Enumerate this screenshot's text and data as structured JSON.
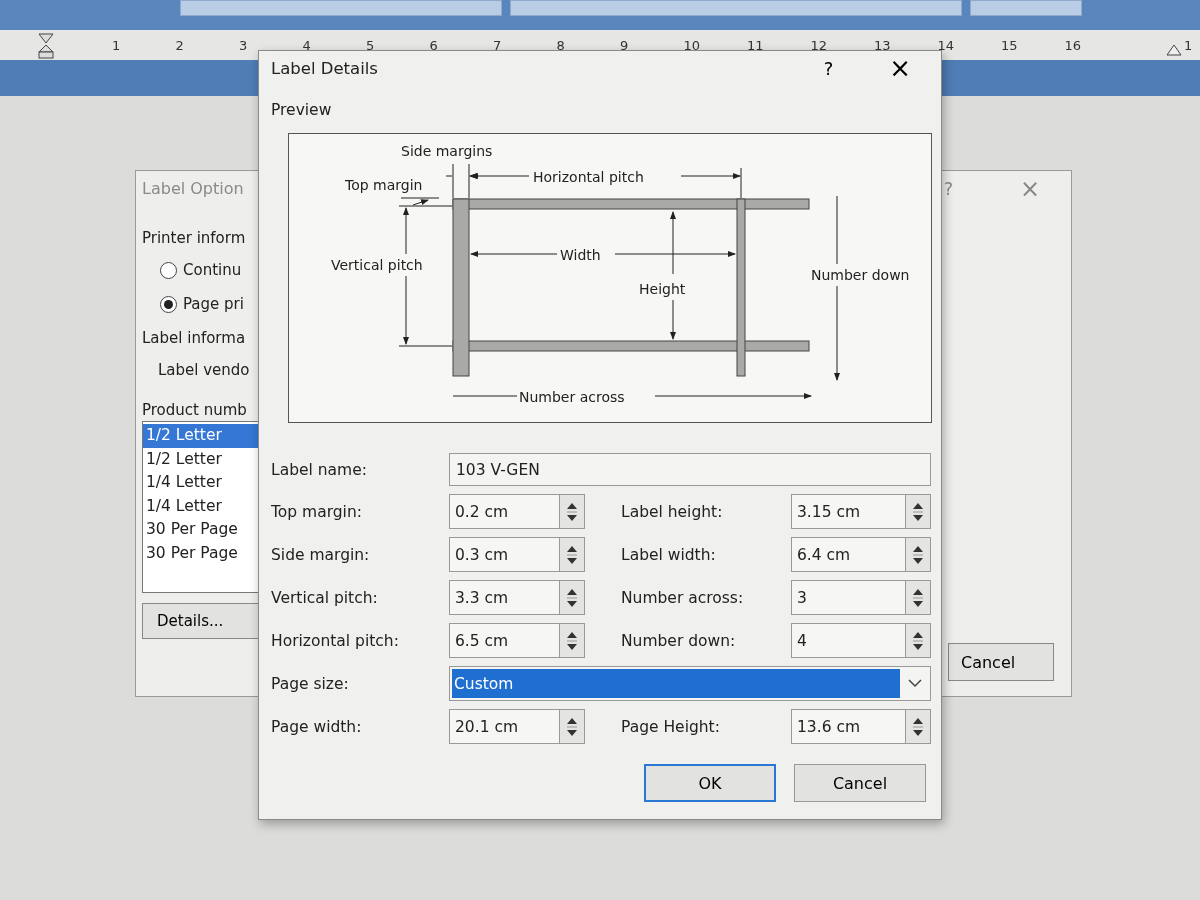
{
  "ruler": {
    "numbers": [
      "1",
      "2",
      "3",
      "4",
      "5",
      "6",
      "7",
      "8",
      "9",
      "10",
      "11",
      "12",
      "13",
      "14",
      "15",
      "16",
      "1"
    ]
  },
  "label_options_dialog": {
    "title": "Label Option",
    "help_button": "?",
    "close_button": "×",
    "printer_info_label": "Printer inform",
    "printer_types": [
      {
        "label": "Continu",
        "selected": false
      },
      {
        "label": "Page pri",
        "selected": true
      }
    ],
    "label_info_label": "Label informa",
    "vendor_label": "Label vendo",
    "product_label": "Product numb",
    "products": [
      {
        "label": "1/2 Letter",
        "selected": true
      },
      {
        "label": "1/2 Letter",
        "selected": false
      },
      {
        "label": "1/4 Letter",
        "selected": false
      },
      {
        "label": "1/4 Letter",
        "selected": false
      },
      {
        "label": "30 Per Page",
        "selected": false
      },
      {
        "label": "30 Per Page",
        "selected": false
      }
    ],
    "details_button": "Details...",
    "cancel_button": "Cancel"
  },
  "label_details_dialog": {
    "title": "Label Details",
    "help_button": "?",
    "close_button": "×",
    "preview_label": "Preview",
    "preview": {
      "side_margins": "Side margins",
      "top_margin": "Top margin",
      "horizontal_pitch": "Horizontal pitch",
      "vertical_pitch": "Vertical pitch",
      "width": "Width",
      "height": "Height",
      "number_down": "Number down",
      "number_across": "Number across"
    },
    "label_name": {
      "label": "Label name:",
      "value": "103 V-GEN"
    },
    "spin_rows": [
      {
        "left": {
          "label": "Top margin:",
          "value": "0.2 cm"
        },
        "right": {
          "label": "Label height:",
          "value": "3.15 cm"
        }
      },
      {
        "left": {
          "label": "Side margin:",
          "value": "0.3 cm"
        },
        "right": {
          "label": "Label width:",
          "value": "6.4 cm"
        }
      },
      {
        "left": {
          "label": "Vertical pitch:",
          "value": "3.3 cm"
        },
        "right": {
          "label": "Number across:",
          "value": "3"
        }
      },
      {
        "left": {
          "label": "Horizontal pitch:",
          "value": "6.5 cm"
        },
        "right": {
          "label": "Number down:",
          "value": "4"
        }
      }
    ],
    "page_size": {
      "label": "Page size:",
      "value": "Custom"
    },
    "page_row": {
      "left": {
        "label": "Page width:",
        "value": "20.1 cm"
      },
      "right": {
        "label": "Page Height:",
        "value": "13.6 cm"
      }
    },
    "buttons": [
      {
        "label": "OK",
        "default": true
      },
      {
        "label": "Cancel",
        "default": false
      }
    ]
  }
}
